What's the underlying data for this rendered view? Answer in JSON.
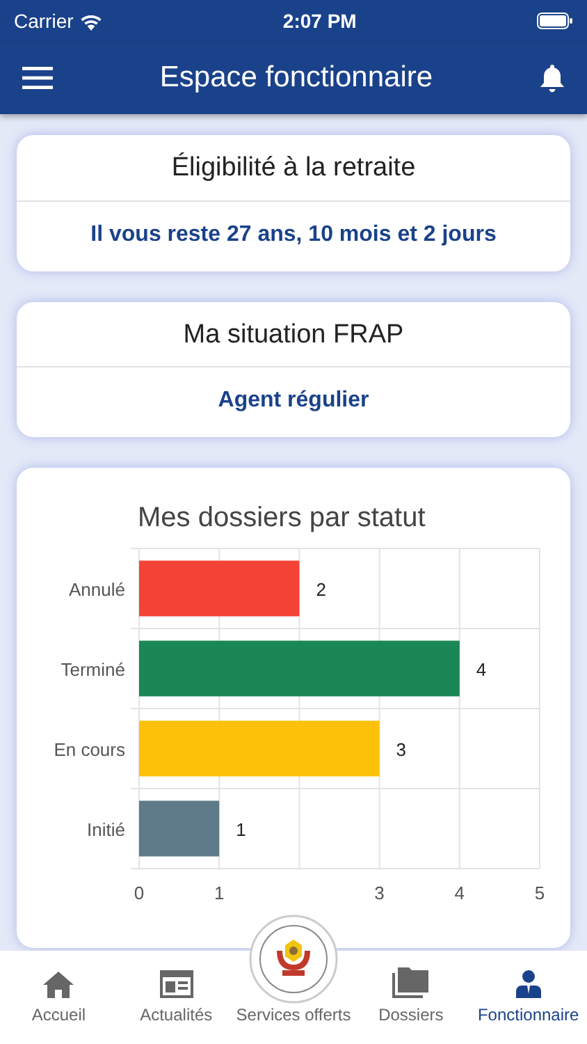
{
  "status_bar": {
    "carrier": "Carrier",
    "time": "2:07 PM"
  },
  "header": {
    "title": "Espace fonctionnaire"
  },
  "cards": [
    {
      "title": "Éligibilité à la retraite",
      "value": "Il vous reste 27 ans, 10 mois et 2 jours"
    },
    {
      "title": "Ma situation FRAP",
      "value": "Agent régulier"
    }
  ],
  "chart_card": {
    "chart_data": {
      "type": "bar",
      "orientation": "horizontal",
      "title": "Mes dossiers par statut",
      "categories": [
        "Annulé",
        "Terminé",
        "En cours",
        "Initié"
      ],
      "series": [
        {
          "values": [
            2,
            4,
            3,
            1
          ],
          "colors": [
            "#f44336",
            "#1b8756",
            "#fdc10a",
            "#5f7a88"
          ]
        }
      ],
      "xlim": [
        0,
        5
      ],
      "grid": true,
      "xticks": [
        0,
        1,
        3,
        4,
        5
      ],
      "data_labels": true
    }
  },
  "tab_bar": [
    {
      "label": "Accueil",
      "kind": "home",
      "selected": false
    },
    {
      "label": "Actualités",
      "kind": "news",
      "selected": false
    },
    {
      "label": "Services offerts",
      "kind": "emblem",
      "selected": false
    },
    {
      "label": "Dossiers",
      "kind": "folder",
      "selected": false
    },
    {
      "label": "Fonctionnaire",
      "kind": "person",
      "selected": true
    }
  ]
}
